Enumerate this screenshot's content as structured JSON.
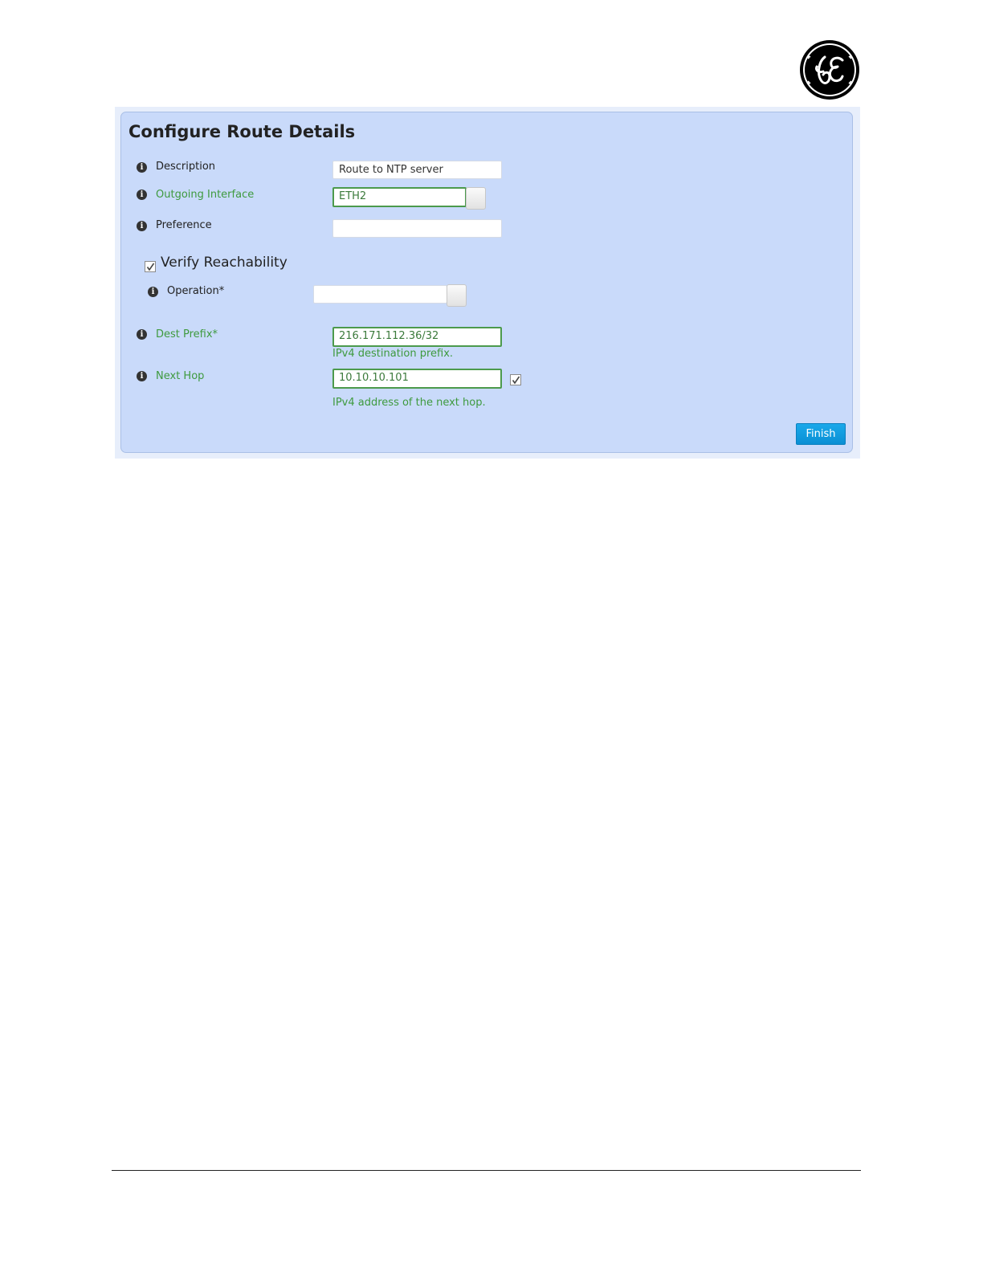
{
  "panel": {
    "title": "Configure Route Details",
    "finish_label": "Finish"
  },
  "fields": {
    "description": {
      "label": "Description",
      "value": "Route to NTP server"
    },
    "outgoing_interface": {
      "label": "Outgoing Interface",
      "value": "ETH2"
    },
    "preference": {
      "label": "Preference",
      "value": ""
    },
    "verify_reachability": {
      "label": "Verify Reachability",
      "checked": true
    },
    "operation": {
      "label": "Operation*",
      "value": ""
    },
    "dest_prefix": {
      "label": "Dest Prefix*",
      "value": "216.171.112.36/32",
      "hint": "IPv4 destination prefix."
    },
    "next_hop": {
      "label": "Next Hop",
      "value": "10.10.10.101",
      "checked": true,
      "hint": "IPv4 address of the next hop."
    }
  },
  "icons": {
    "info": "info-icon",
    "logo": "ge-logo"
  },
  "colors": {
    "panel_background": "#c9dafa",
    "valid_field": "#3e9a3e",
    "finish_button": "#0a9ae0"
  }
}
